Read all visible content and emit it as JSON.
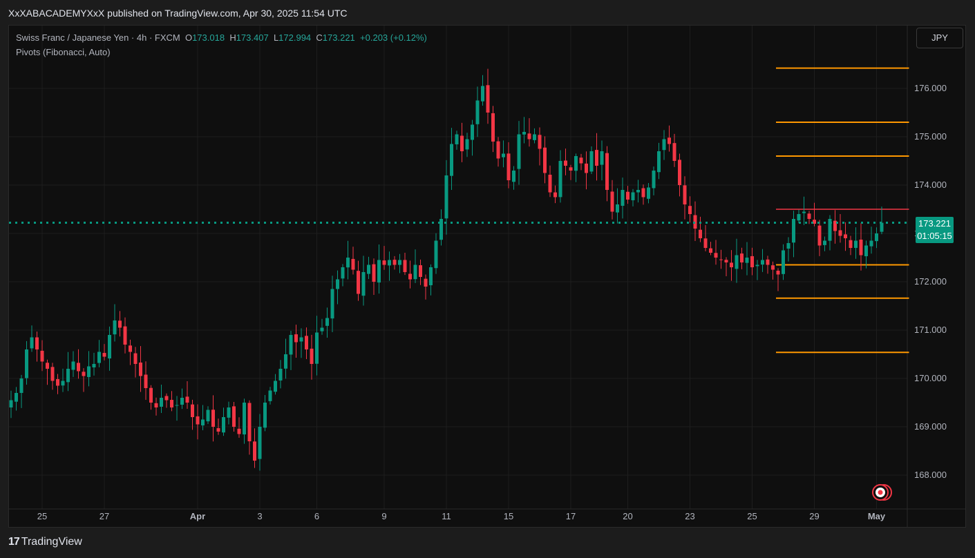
{
  "header": {
    "published_line": "XxXABACADEMYXxX published on TradingView.com, Apr 30, 2025 11:54 UTC"
  },
  "legend": {
    "symbol": "Swiss Franc / Japanese Yen · 4h · FXCM",
    "open_label": "O",
    "open": "173.018",
    "high_label": "H",
    "high": "173.407",
    "low_label": "L",
    "low": "172.994",
    "close_label": "C",
    "close": "173.221",
    "change": "+0.203 (+0.12%)",
    "indicator": "Pivots (Fibonacci, Auto)"
  },
  "currency_button": "JPY",
  "price_tag": {
    "price": "173.221",
    "countdown": "01:05:15"
  },
  "footer": {
    "logo_mark": "17",
    "brand": "TradingView"
  },
  "colors": {
    "up": "#089981",
    "down": "#f23645",
    "pivot": "#ff9800",
    "resistance_line": "#f23645",
    "background": "#0f0f0f",
    "grid": "#1e1e1e"
  },
  "chart_data": {
    "type": "candlestick",
    "symbol": "CHFJPY",
    "timeframe": "4h",
    "y_ticks": [
      "176.000",
      "175.000",
      "174.000",
      "173.000",
      "172.000",
      "171.000",
      "170.000",
      "169.000",
      "168.000"
    ],
    "y_range": [
      167.3,
      177.3
    ],
    "x_ticks": [
      {
        "label": "25",
        "index": 6
      },
      {
        "label": "27",
        "index": 18
      },
      {
        "label": "Apr",
        "index": 36,
        "bold": true
      },
      {
        "label": "3",
        "index": 48
      },
      {
        "label": "6",
        "index": 59
      },
      {
        "label": "9",
        "index": 72
      },
      {
        "label": "11",
        "index": 84
      },
      {
        "label": "15",
        "index": 96
      },
      {
        "label": "17",
        "index": 108
      },
      {
        "label": "20",
        "index": 119
      },
      {
        "label": "23",
        "index": 131
      },
      {
        "label": "25",
        "index": 143
      },
      {
        "label": "29",
        "index": 155
      },
      {
        "label": "May",
        "index": 167,
        "bold": true
      }
    ],
    "last_price": 173.221,
    "pivot_levels": [
      176.42,
      175.3,
      174.6,
      172.35,
      171.66,
      170.54
    ],
    "pivot_x_range": [
      148,
      173
    ],
    "resistance_line": 173.5,
    "closes": [
      169.55,
      169.7,
      170.0,
      170.6,
      170.85,
      170.6,
      170.35,
      170.2,
      169.95,
      169.85,
      169.95,
      170.2,
      170.35,
      170.15,
      170.05,
      170.25,
      170.3,
      170.55,
      170.45,
      170.9,
      171.2,
      171.05,
      170.7,
      170.55,
      170.3,
      170.05,
      169.8,
      169.5,
      169.4,
      169.6,
      169.55,
      169.4,
      169.45,
      169.6,
      169.5,
      169.2,
      169.05,
      169.15,
      169.35,
      169.0,
      168.9,
      169.2,
      169.4,
      169.0,
      168.85,
      169.5,
      168.7,
      168.3,
      169.0,
      169.5,
      169.75,
      169.95,
      170.2,
      170.5,
      170.9,
      170.75,
      170.85,
      170.6,
      170.3,
      170.95,
      171.05,
      171.25,
      171.85,
      172.05,
      172.3,
      172.5,
      172.25,
      171.75,
      172.2,
      172.35,
      172.0,
      172.45,
      172.35,
      172.45,
      172.35,
      172.45,
      172.2,
      172.05,
      172.35,
      172.1,
      171.9,
      172.3,
      172.85,
      173.3,
      174.2,
      174.85,
      175.05,
      174.7,
      174.95,
      175.25,
      175.75,
      176.05,
      175.5,
      174.9,
      174.55,
      174.65,
      174.1,
      174.3,
      175.05,
      175.1,
      174.95,
      175.05,
      174.75,
      174.25,
      173.85,
      173.75,
      174.5,
      174.4,
      174.3,
      174.6,
      174.45,
      174.25,
      174.7,
      174.4,
      174.7,
      173.9,
      173.45,
      173.6,
      173.9,
      173.7,
      173.85,
      173.9,
      173.75,
      173.95,
      174.3,
      174.7,
      174.95,
      174.85,
      174.5,
      174.0,
      173.6,
      173.4,
      173.1,
      172.9,
      172.7,
      172.6,
      172.5,
      172.45,
      172.4,
      172.3,
      172.55,
      172.4,
      172.5,
      172.3,
      172.35,
      172.45,
      172.35,
      172.25,
      172.15,
      172.65,
      172.8,
      173.3,
      173.4,
      173.45,
      173.3,
      173.2,
      172.75,
      172.85,
      173.3,
      173.05,
      172.95,
      172.9,
      172.7,
      172.85,
      172.55,
      172.75,
      172.85,
      173.0,
      173.221
    ]
  }
}
